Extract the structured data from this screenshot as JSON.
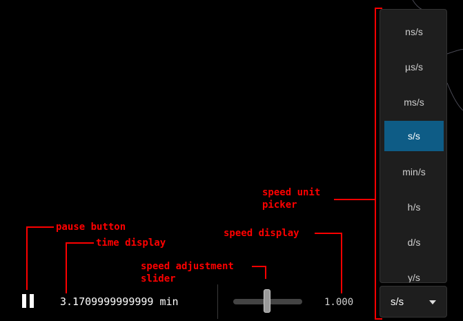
{
  "controls": {
    "pause_icon": "pause-icon",
    "time_value": "3.1709999999999 min",
    "slider_position": 0.49,
    "speed_value": "1.000"
  },
  "unit_picker": {
    "options": [
      "ns/s",
      "µs/s",
      "ms/s",
      "s/s",
      "min/s",
      "h/s",
      "d/s",
      "y/s"
    ],
    "selected_index": 3,
    "current_value": "s/s",
    "caret_icon": "caret-down-icon"
  },
  "annotations": {
    "pause_button": "pause button",
    "time_display": "time display",
    "speed_slider": "speed adjustment\nslider",
    "speed_display": "speed display",
    "unit_picker": "speed unit\npicker"
  },
  "colors": {
    "background": "#000000",
    "selected_option": "#0e5c86",
    "annotation": "#ff0000"
  }
}
